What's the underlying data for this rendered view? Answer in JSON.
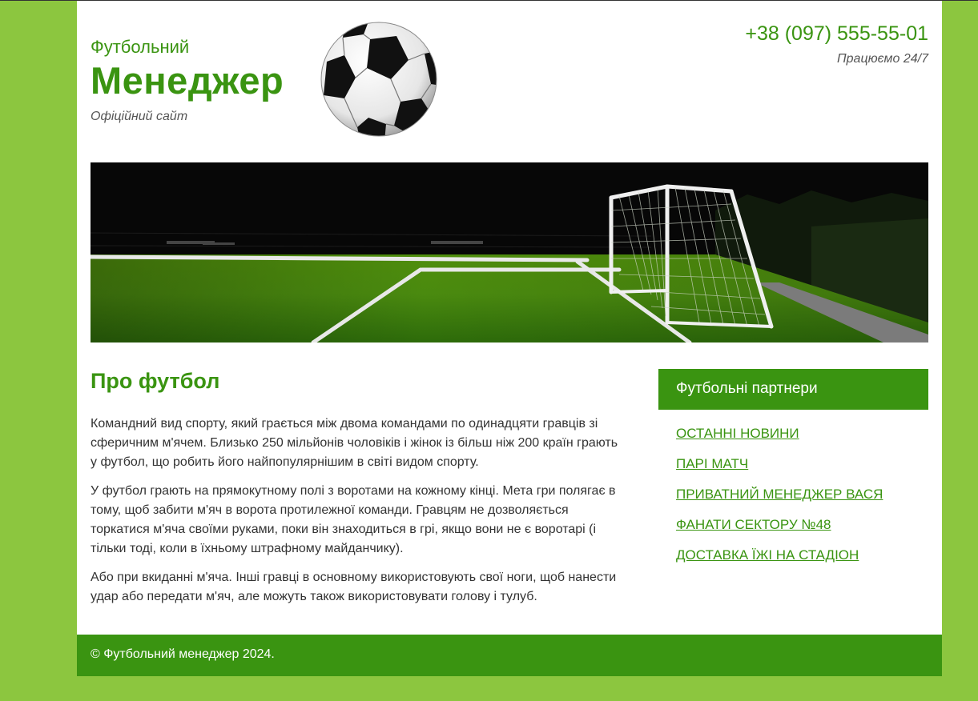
{
  "header": {
    "logo_small": "Футбольний",
    "logo_big": "Менеджер",
    "logo_sub": "Офіційний сайт",
    "phone": "+38 (097) 555-55-01",
    "hours": "Працюємо 24/7"
  },
  "images": {
    "ball": "soccer-ball-icon",
    "banner": "football-goal-field-photo"
  },
  "main": {
    "title": "Про футбол",
    "paragraphs": [
      "Командний вид спорту, який грається між двома командами по одинадцяти гравців зі сферичним м'ячем. Близько 250 мільйонів чоловіків і жінок із більш ніж 200 країн грають у футбол, що робить його найпопулярнішим в світі видом спорту.",
      "У футбол грають на прямокутному полі з воротами на кожному кінці. Мета гри полягає в тому, щоб забити м'яч в ворота протилежної команди. Гравцям не дозволяється торкатися м'яча своїми руками, поки він знаходиться в грі, якщо вони не є воротарі (і тільки тоді, коли в їхньому штрафному майданчику).",
      "Або при вкиданні м'яча. Інші гравці в основному використовують свої ноги, щоб нанести удар або передати м'яч, але можуть також використовувати голову і тулуб."
    ]
  },
  "sidebar": {
    "title": "Футбольні партнери",
    "links": [
      "ОСТАННІ НОВИНИ",
      "ПАРІ МАТЧ",
      "ПРИВАТНИЙ МЕНЕДЖЕР ВАСЯ",
      "ФАНАТИ СЕКТОРУ №48",
      "ДОСТАВКА ЇЖІ НА СТАДІОН"
    ]
  },
  "footer": {
    "text": "© Футбольний менеджер 2024."
  },
  "colors": {
    "page_bg": "#8cc63f",
    "accent": "#3a9411",
    "text": "#333333"
  }
}
